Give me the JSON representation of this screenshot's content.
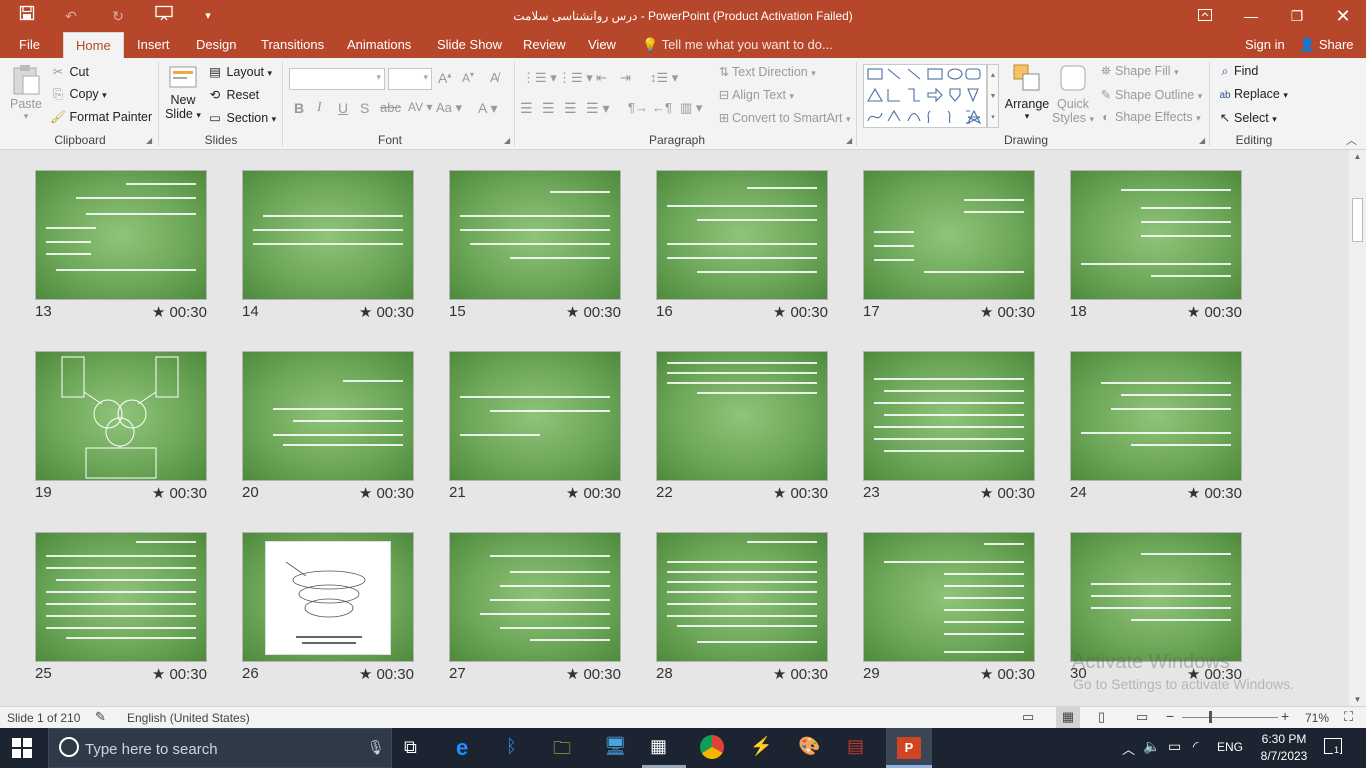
{
  "window": {
    "title": "درس روانشناسی سلامت - PowerPoint (Product Activation Failed)",
    "title_bg": "#b7472a"
  },
  "tabs": [
    {
      "label": "File"
    },
    {
      "label": "Home",
      "active": true
    },
    {
      "label": "Insert"
    },
    {
      "label": "Design"
    },
    {
      "label": "Transitions"
    },
    {
      "label": "Animations"
    },
    {
      "label": "Slide Show"
    },
    {
      "label": "Review"
    },
    {
      "label": "View"
    }
  ],
  "tell_me": "Tell me what you want to do...",
  "sign_in": "Sign in",
  "share": "Share",
  "ribbon": {
    "clipboard": {
      "label": "Clipboard",
      "paste": "Paste",
      "cut": "Cut",
      "copy": "Copy",
      "format_painter": "Format Painter"
    },
    "slides": {
      "label": "Slides",
      "new_slide_1": "New",
      "new_slide_2": "Slide",
      "layout": "Layout",
      "reset": "Reset",
      "section": "Section"
    },
    "font": {
      "label": "Font"
    },
    "paragraph": {
      "label": "Paragraph",
      "text_direction": "Text Direction",
      "align_text": "Align Text",
      "convert_smartart": "Convert to SmartArt"
    },
    "drawing": {
      "label": "Drawing",
      "arrange": "Arrange",
      "quick_styles_1": "Quick",
      "quick_styles_2": "Styles",
      "shape_fill": "Shape Fill",
      "shape_outline": "Shape Outline",
      "shape_effects": "Shape Effects"
    },
    "editing": {
      "label": "Editing",
      "find": "Find",
      "replace": "Replace",
      "select": "Select"
    }
  },
  "slides": [
    {
      "num": "13",
      "time": "★ 00:30"
    },
    {
      "num": "14",
      "time": "★ 00:30"
    },
    {
      "num": "15",
      "time": "★ 00:30"
    },
    {
      "num": "16",
      "time": "★ 00:30"
    },
    {
      "num": "17",
      "time": "★ 00:30"
    },
    {
      "num": "18",
      "time": "★ 00:30"
    },
    {
      "num": "19",
      "time": "★ 00:30"
    },
    {
      "num": "20",
      "time": "★ 00:30"
    },
    {
      "num": "21",
      "time": "★ 00:30"
    },
    {
      "num": "22",
      "time": "★ 00:30"
    },
    {
      "num": "23",
      "time": "★ 00:30"
    },
    {
      "num": "24",
      "time": "★ 00:30"
    },
    {
      "num": "25",
      "time": "★ 00:30"
    },
    {
      "num": "26",
      "time": "★ 00:30"
    },
    {
      "num": "27",
      "time": "★ 00:30"
    },
    {
      "num": "28",
      "time": "★ 00:30"
    },
    {
      "num": "29",
      "time": "★ 00:30"
    },
    {
      "num": "30",
      "time": "★ 00:30"
    }
  ],
  "watermark": {
    "line1": "Activate Windows",
    "line2": "Go to Settings to activate Windows."
  },
  "status": {
    "slide_info": "Slide 1 of 210",
    "language": "English (United States)",
    "zoom": "71%"
  },
  "taskbar": {
    "search_placeholder": "Type here to search",
    "lang": "ENG",
    "time": "6:30 PM",
    "date": "8/7/2023",
    "notifications": "1"
  }
}
